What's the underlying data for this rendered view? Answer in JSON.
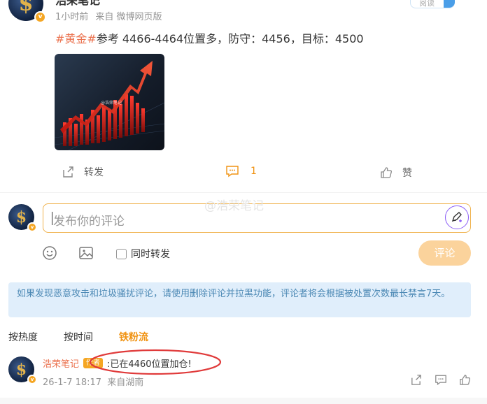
{
  "post": {
    "author_name": "浩荣笔记",
    "time": "1小时前",
    "source": "来自 微博网页版",
    "read_button": "阅读",
    "tag": "#黄金#",
    "text": "参考 4466-4464位置多，防守：4456，目标：4500",
    "image_watermark": "@浩荣笔记",
    "actions": {
      "repost_label": "转发",
      "comment_count": "1",
      "like_label": "赞"
    }
  },
  "compose": {
    "placeholder": "发布你的评论",
    "repost_checkbox_label": "同时转发",
    "submit_label": "评论",
    "overlay_watermark": "@浩荣笔记"
  },
  "notice": {
    "text": "如果发现恶意攻击和垃圾骚扰评论，请使用删除评论并拉黑功能，评论者将会根据被处置次数最长禁言7天。"
  },
  "sort_tabs": [
    {
      "label": "按热度",
      "active": false
    },
    {
      "label": "按时间",
      "active": false
    },
    {
      "label": "铁粉流",
      "active": true
    }
  ],
  "comments": [
    {
      "user": "浩荣笔记",
      "badge": "作者",
      "text": ":已在4460位置加仓!",
      "time": "26-1-7 18:17",
      "location": "来自湖南"
    }
  ],
  "icons": {
    "avatar": "dollar-gold-avatar-icon",
    "verified": "verified-badge-icon",
    "repost": "repost-icon",
    "comment": "comment-icon",
    "like": "like-thumb-icon",
    "emoji": "emoji-icon",
    "image": "image-icon",
    "pen": "pen-assist-icon"
  },
  "colors": {
    "accent_orange": "#f09211",
    "tag_orange": "#eb7350",
    "annotation_red": "#e03a3a",
    "notice_bg": "#e0eefb",
    "submit_disabled": "#fbd39c"
  }
}
